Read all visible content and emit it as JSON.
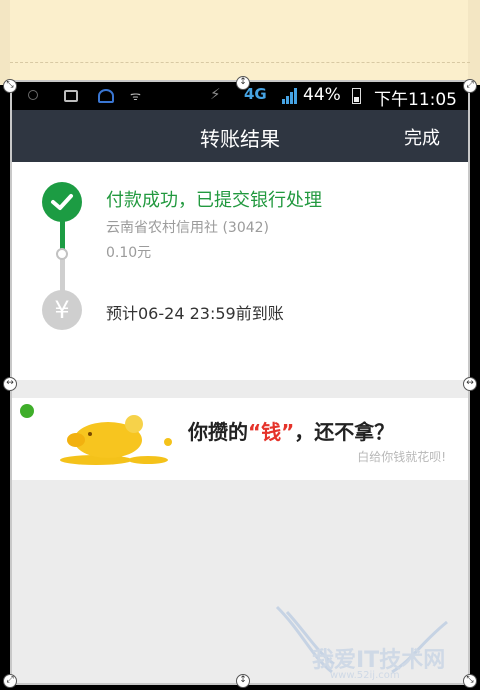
{
  "status_bar": {
    "network": "4G",
    "battery": "44%",
    "time": "下午11:05"
  },
  "header": {
    "title": "转账结果",
    "done_label": "完成"
  },
  "result": {
    "success_text": "付款成功，已提交银行处理",
    "bank": "云南省农村信用社 (3042)",
    "amount": "0.10元",
    "eta": "预计06-24 23:59前到账",
    "yen_symbol": "¥"
  },
  "ad": {
    "headline_pre": "你攒的",
    "headline_highlight": "“钱”",
    "headline_post": "，还不拿？",
    "subline": "白给你钱就花呗!"
  },
  "watermark": {
    "text": "我爱IT技术网",
    "url": "www.52ij.com"
  },
  "colors": {
    "titlebar": "#2f3641",
    "success_green": "#1c9c43",
    "highlight_red": "#e5332a"
  }
}
